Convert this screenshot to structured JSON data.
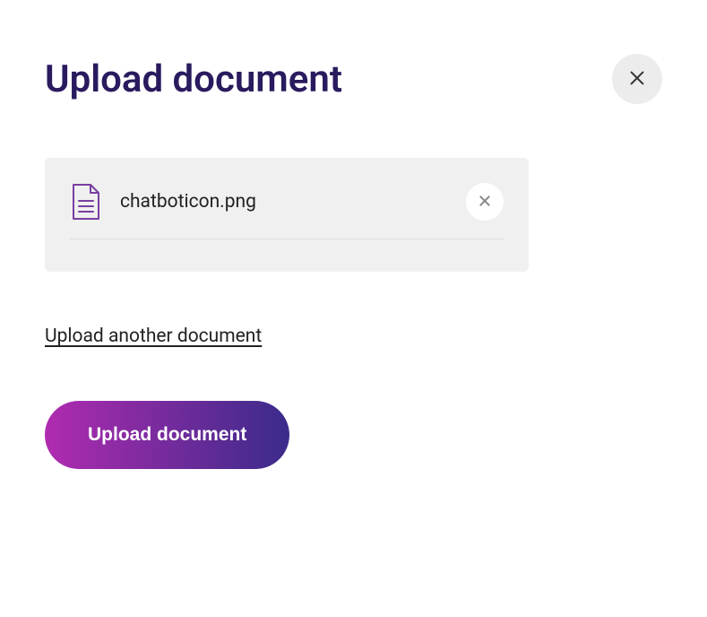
{
  "header": {
    "title": "Upload document"
  },
  "file": {
    "name": "chatboticon.png"
  },
  "links": {
    "upload_another_label": "Upload another document"
  },
  "buttons": {
    "upload_label": "Upload document"
  }
}
